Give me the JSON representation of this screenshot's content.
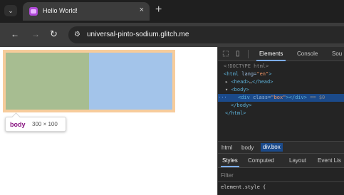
{
  "browser": {
    "tab_title": "Hello World!",
    "tab_close": "×",
    "new_tab": "+",
    "back": "←",
    "forward": "→",
    "reload": "↻",
    "url": "universal-pinto-sodium.glitch.me",
    "site_info_icon": "⚙"
  },
  "viewport": {
    "tooltip_tag": "body",
    "tooltip_size": "300 × 100",
    "colors": {
      "green": "#a7bd91",
      "blue": "#a3c4ea",
      "margin": "#f7cc9b"
    }
  },
  "devtools": {
    "tabs": [
      "Elements",
      "Console",
      "Sou"
    ],
    "dom": {
      "doctype": "<!DOCTYPE html>",
      "html_open_tag": "<html",
      "html_attr": " lang=",
      "html_attr_val": "\"en\"",
      "html_close_bracket": ">",
      "head": "<head>",
      "head_ellipsis": "…",
      "head_close": "</head>",
      "body_open": "<body>",
      "div_open": "<div",
      "div_attr": " class=",
      "div_attr_val": "\"box\"",
      "div_close": "></div>",
      "div_ref": "== $0",
      "body_close": "</body>",
      "html_close": "</html>"
    },
    "breadcrumbs": [
      "html",
      "body",
      "div.box"
    ],
    "subtabs": [
      "Styles",
      "Computed",
      "Layout",
      "Event Lis"
    ],
    "filter_placeholder": "Filter",
    "style_rule": "element.style {"
  }
}
